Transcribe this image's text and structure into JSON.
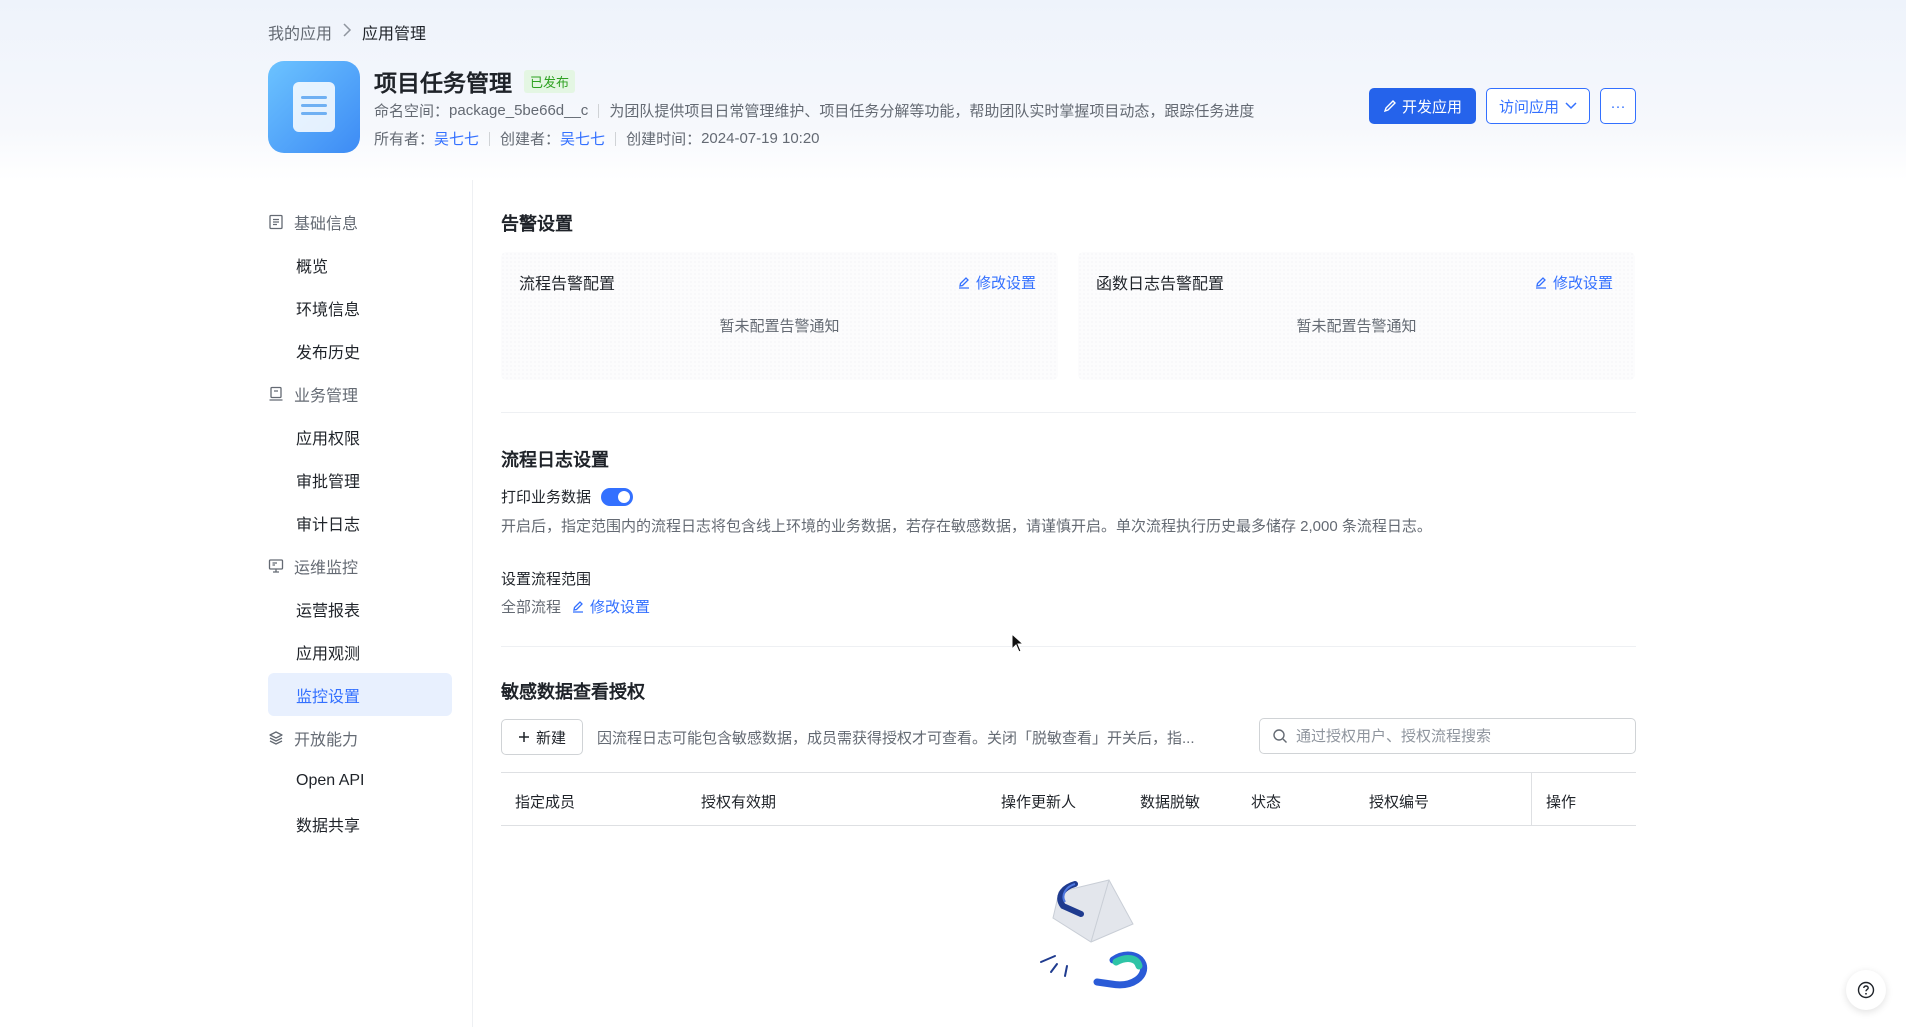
{
  "breadcrumb": {
    "parent": "我的应用",
    "current": "应用管理"
  },
  "app": {
    "title": "项目任务管理",
    "status_badge": "已发布",
    "namespace_label": "命名空间：",
    "namespace_value": "package_5be66d__c",
    "description": "为团队提供项目日常管理维护、项目任务分解等功能，帮助团队实时掌握项目动态，跟踪任务进度",
    "owner_label": "所有者：",
    "owner": "吴七七",
    "creator_label": "创建者：",
    "creator": "吴七七",
    "created_label": "创建时间：",
    "created_time": "2024-07-19 10:20"
  },
  "actions": {
    "develop": "开发应用",
    "visit": "访问应用",
    "more": "···"
  },
  "sidebar": {
    "groups": [
      {
        "label": "基础信息",
        "icon": "document-icon",
        "items": [
          "概览",
          "环境信息",
          "发布历史"
        ]
      },
      {
        "label": "业务管理",
        "icon": "briefcase-icon",
        "items": [
          "应用权限",
          "审批管理",
          "审计日志"
        ]
      },
      {
        "label": "运维监控",
        "icon": "monitor-icon",
        "items": [
          "运营报表",
          "应用观测",
          "监控设置"
        ]
      },
      {
        "label": "开放能力",
        "icon": "layers-icon",
        "items": [
          "Open API",
          "数据共享"
        ]
      }
    ],
    "active": "监控设置"
  },
  "alert": {
    "title": "告警设置",
    "cards": [
      {
        "title": "流程告警配置",
        "edit": "修改设置",
        "empty": "暂未配置告警通知"
      },
      {
        "title": "函数日志告警配置",
        "edit": "修改设置",
        "empty": "暂未配置告警通知"
      }
    ]
  },
  "flow_log": {
    "title": "流程日志设置",
    "toggle_label": "打印业务数据",
    "toggle_on": true,
    "description": "开启后，指定范围内的流程日志将包含线上环境的业务数据，若存在敏感数据，请谨慎开启。单次流程执行历史最多储存 2,000 条流程日志。",
    "scope_label": "设置流程范围",
    "scope_value": "全部流程",
    "scope_edit": "修改设置"
  },
  "auth": {
    "title": "敏感数据查看授权",
    "new_button": "新建",
    "description": "因流程日志可能包含敏感数据，成员需获得授权才可查看。关闭「脱敏查看」开关后，指...",
    "search_placeholder": "通过授权用户、授权流程搜索",
    "columns": [
      "指定成员",
      "授权有效期",
      "操作更新人",
      "数据脱敏",
      "状态",
      "授权编号",
      "操作"
    ]
  },
  "colors": {
    "primary": "#3370ff",
    "button_primary": "#2563eb",
    "badge_green": "#2ea121"
  }
}
